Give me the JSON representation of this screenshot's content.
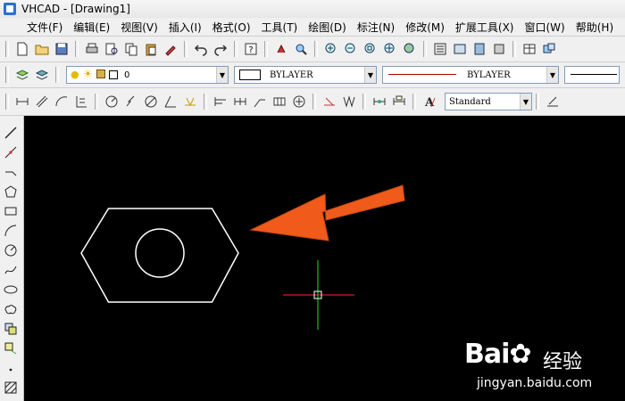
{
  "window": {
    "title": "VHCAD - [Drawing1]"
  },
  "menu": [
    "文件(F)",
    "编辑(E)",
    "视图(V)",
    "插入(I)",
    "格式(O)",
    "工具(T)",
    "绘图(D)",
    "标注(N)",
    "修改(M)",
    "扩展工具(X)",
    "窗口(W)",
    "帮助(H)"
  ],
  "properties": {
    "layer_value": "0",
    "color_value": "BYLAYER",
    "linetype_value": "BYLAYER",
    "text_style_value": "Standard"
  },
  "icons": {
    "standard_toolbar": [
      "new-icon",
      "open-icon",
      "save-icon",
      "print-icon",
      "print-preview-icon",
      "copy-icon",
      "paste-icon",
      "match-properties-icon",
      "undo-icon",
      "redo-icon",
      "help-icon",
      "pan-icon",
      "zoom-realtime-icon",
      "zoom-in-icon",
      "zoom-out-icon",
      "zoom-window-icon",
      "zoom-extents-icon",
      "zoom-all-icon",
      "properties-icon",
      "design-center-icon",
      "tool-palette-icon",
      "block-icon",
      "table-icon",
      "external-ref-icon"
    ],
    "dimension_toolbar": [
      "linear-dim-icon",
      "aligned-dim-icon",
      "arc-length-icon",
      "ordinate-dim-icon",
      "radius-dim-icon",
      "jogged-dim-icon",
      "diameter-dim-icon",
      "angular-dim-icon",
      "quick-dim-icon",
      "baseline-dim-icon",
      "continue-dim-icon",
      "quick-leader-icon",
      "tolerance-icon",
      "center-mark-icon",
      "dim-edit-icon",
      "dim-text-edit-icon",
      "dim-update-icon",
      "dim-style-icon"
    ],
    "draw_toolbar": [
      "line-icon",
      "construction-line-icon",
      "polyline-icon",
      "polygon-icon",
      "rectangle-icon",
      "arc-icon",
      "circle-icon",
      "spline-icon",
      "ellipse-icon",
      "revision-cloud-icon",
      "insert-block-icon",
      "make-block-icon",
      "point-icon",
      "hatch-icon"
    ]
  },
  "drawing": {
    "background": "#000000",
    "hexagon_color": "#ffffff",
    "circle_color": "#ffffff",
    "arrow_color": "#f05a1a",
    "crosshair_x_color": "#cc2222",
    "crosshair_y_color": "#22aa22"
  },
  "watermark": {
    "brand": "Bai",
    "brand2": "经验",
    "url": "jingyan.baidu.com"
  }
}
